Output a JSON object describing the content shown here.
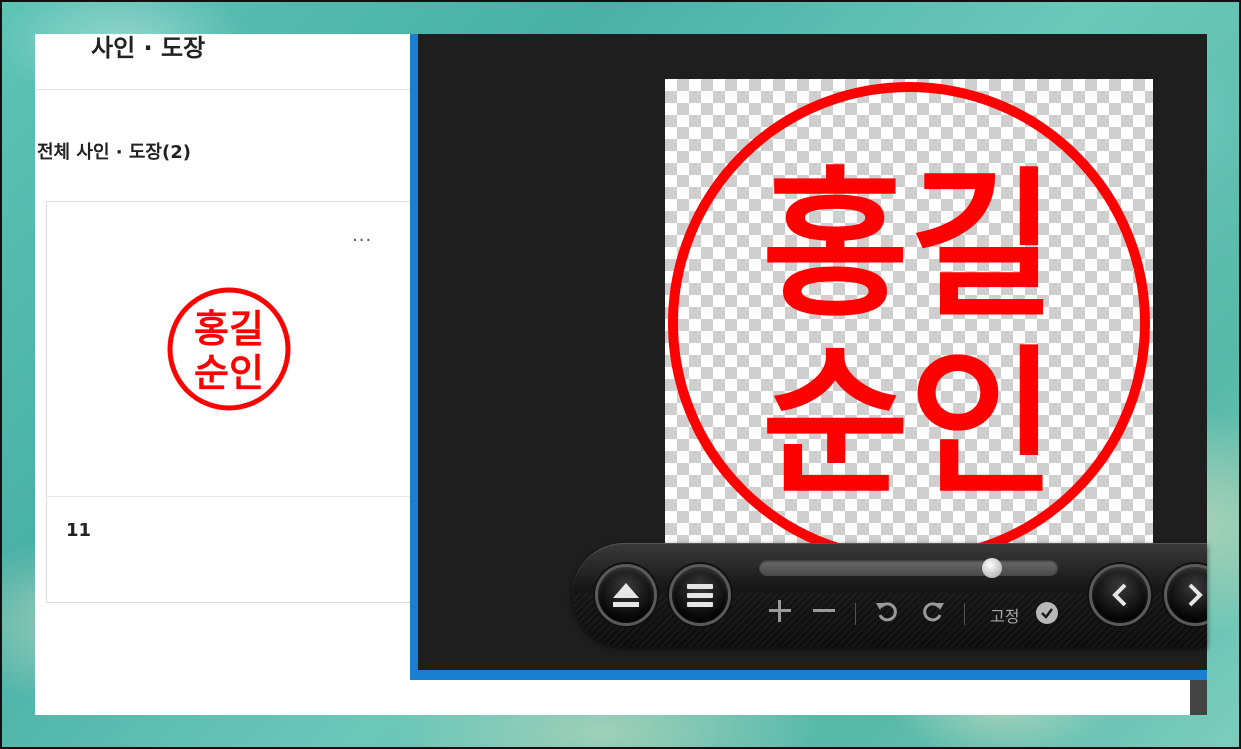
{
  "page": {
    "title": "사인 · 도장",
    "section_label": "전체 사인 · 도장(2)"
  },
  "card": {
    "more_label": "···",
    "stamp_text_line1": "홍길",
    "stamp_text_line2": "순인",
    "name": "11"
  },
  "viewer": {
    "stamp_text_line1": "홍길",
    "stamp_text_line2": "순인",
    "stamp_color": "#ff0000",
    "accent_color": "#1a7fd0"
  },
  "controls": {
    "buttons": [
      "eject-icon",
      "menu-icon",
      "zoom-in-icon",
      "zoom-out-icon",
      "rotate-left-icon",
      "rotate-right-icon",
      "prev-icon",
      "next-icon"
    ],
    "progress_fraction": 0.8,
    "fix_label": "고정",
    "fix_checked": true
  }
}
